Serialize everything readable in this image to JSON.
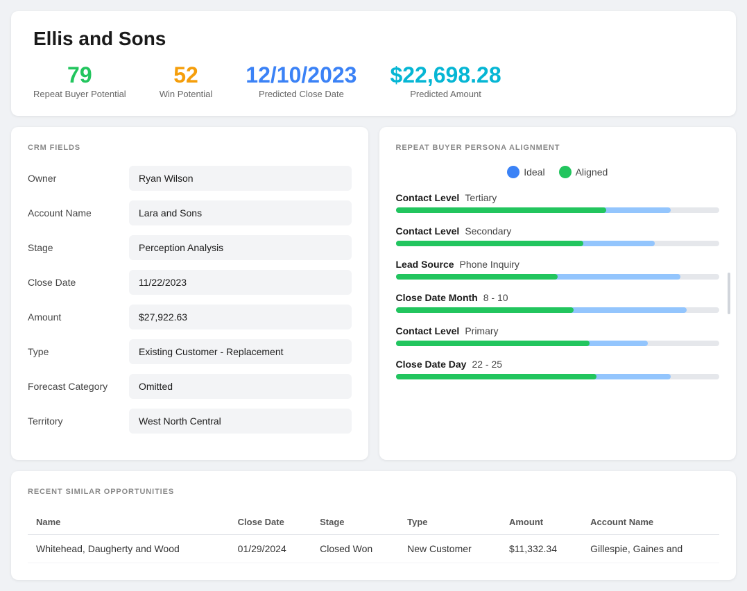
{
  "header": {
    "title": "Ellis and Sons",
    "metrics": [
      {
        "id": "repeat-buyer",
        "value": "79",
        "label": "Repeat Buyer Potential",
        "color": "color-green"
      },
      {
        "id": "win-potential",
        "value": "52",
        "label": "Win Potential",
        "color": "color-orange"
      },
      {
        "id": "predicted-close",
        "value": "12/10/2023",
        "label": "Predicted Close Date",
        "color": "color-blue"
      },
      {
        "id": "predicted-amount",
        "value": "$22,698.28",
        "label": "Predicted Amount",
        "color": "color-teal"
      }
    ]
  },
  "crm": {
    "section_title": "CRM FIELDS",
    "fields": [
      {
        "label": "Owner",
        "value": "Ryan Wilson"
      },
      {
        "label": "Account Name",
        "value": "Lara and Sons"
      },
      {
        "label": "Stage",
        "value": "Perception Analysis"
      },
      {
        "label": "Close Date",
        "value": "11/22/2023"
      },
      {
        "label": "Amount",
        "value": "$27,922.63"
      },
      {
        "label": "Type",
        "value": "Existing Customer - Replacement"
      },
      {
        "label": "Forecast Category",
        "value": "Omitted"
      },
      {
        "label": "Territory",
        "value": "West North Central"
      }
    ]
  },
  "persona": {
    "section_title": "REPEAT BUYER PERSONA ALIGNMENT",
    "legend": {
      "ideal_label": "Ideal",
      "aligned_label": "Aligned"
    },
    "alignments": [
      {
        "key": "Contact Level",
        "value": "Tertiary",
        "ideal_pct": 85,
        "aligned_pct": 65
      },
      {
        "key": "Contact Level",
        "value": "Secondary",
        "ideal_pct": 80,
        "aligned_pct": 58
      },
      {
        "key": "Lead Source",
        "value": "Phone Inquiry",
        "ideal_pct": 88,
        "aligned_pct": 50
      },
      {
        "key": "Close Date Month",
        "value": "8 - 10",
        "ideal_pct": 90,
        "aligned_pct": 55
      },
      {
        "key": "Contact Level",
        "value": "Primary",
        "ideal_pct": 78,
        "aligned_pct": 60
      },
      {
        "key": "Close Date Day",
        "value": "22 - 25",
        "ideal_pct": 85,
        "aligned_pct": 62
      }
    ]
  },
  "recent": {
    "section_title": "RECENT SIMILAR OPPORTUNITIES",
    "columns": [
      "Name",
      "Close Date",
      "Stage",
      "Type",
      "Amount",
      "Account Name"
    ],
    "rows": [
      {
        "name": "Whitehead, Daugherty and Wood",
        "close_date": "01/29/2024",
        "stage": "Closed Won",
        "type": "New Customer",
        "amount": "$11,332.34",
        "account_name": "Gillespie, Gaines and"
      }
    ]
  }
}
